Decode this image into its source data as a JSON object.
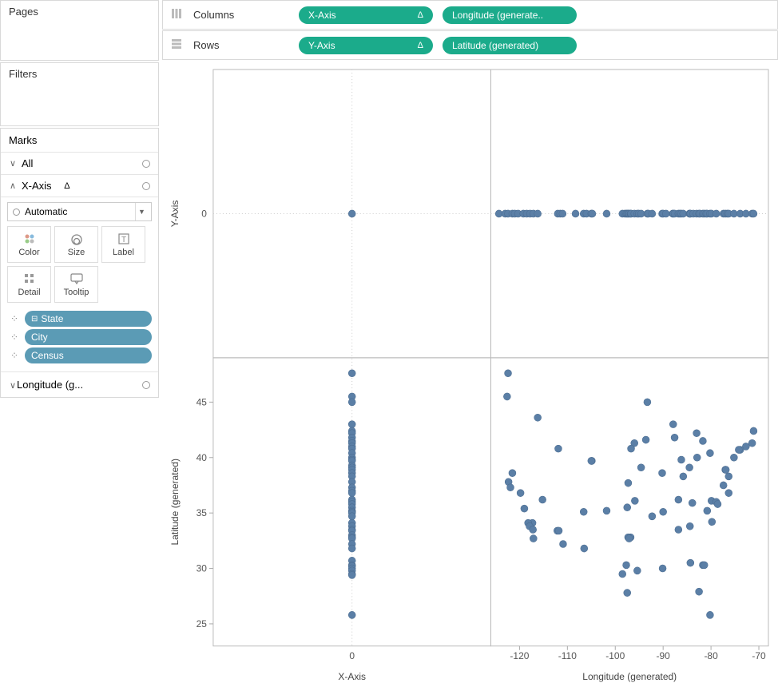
{
  "panels": {
    "pages": "Pages",
    "filters": "Filters",
    "marks": "Marks",
    "all": "All",
    "xaxis_item": "X-Axis",
    "delta": "Δ",
    "automatic": "Automatic",
    "color": "Color",
    "size": "Size",
    "label": "Label",
    "detail": "Detail",
    "tooltip": "Tooltip",
    "state": "State",
    "city": "City",
    "census": "Census",
    "longitude_g": "Longitude (g..."
  },
  "shelves": {
    "columns": "Columns",
    "rows": "Rows",
    "xaxis": "X-Axis",
    "lon_gen_trunc": "Longitude (generate..",
    "yaxis": "Y-Axis",
    "lat_gen": "Latitude (generated)"
  },
  "chart_data": {
    "type": "scatter",
    "panels_layout": "2x2",
    "column_fields": [
      "X-Axis",
      "Longitude (generated)"
    ],
    "row_fields": [
      "Y-Axis",
      "Latitude (generated)"
    ],
    "x_axes": {
      "xaxis_label": "X-Axis",
      "lon_label": "Longitude (generated)",
      "xaxis_ticks": [
        0
      ],
      "lon_ticks": [
        -120,
        -110,
        -100,
        -90,
        -80,
        -70
      ],
      "xaxis_range": [
        -0.5,
        0.5
      ],
      "lon_range": [
        -126,
        -68
      ]
    },
    "y_axes": {
      "yaxis_label": "Y-Axis",
      "lat_label": "Latitude (generated)",
      "yaxis_ticks": [
        0
      ],
      "lat_ticks": [
        25,
        30,
        35,
        40,
        45
      ],
      "yaxis_range": [
        -0.5,
        0.5
      ],
      "lat_range": [
        23,
        49
      ]
    },
    "series": [
      {
        "name": "top-left (X-Axis vs Y-Axis)",
        "points": [
          [
            0,
            0
          ]
        ]
      },
      {
        "name": "top-right (Longitude vs Y-Axis)",
        "points": [
          [
            -124.3,
            0
          ],
          [
            -123.0,
            0
          ],
          [
            -122.4,
            0
          ],
          [
            -121.5,
            0
          ],
          [
            -121.0,
            0
          ],
          [
            -120.3,
            0
          ],
          [
            -119.2,
            0
          ],
          [
            -118.5,
            0
          ],
          [
            -117.8,
            0
          ],
          [
            -117.1,
            0
          ],
          [
            -116.2,
            0
          ],
          [
            -112.0,
            0
          ],
          [
            -111.5,
            0
          ],
          [
            -111.0,
            0
          ],
          [
            -108.3,
            0
          ],
          [
            -106.6,
            0
          ],
          [
            -106.0,
            0
          ],
          [
            -105.0,
            0
          ],
          [
            -104.8,
            0
          ],
          [
            -101.8,
            0
          ],
          [
            -98.5,
            0
          ],
          [
            -98.0,
            0
          ],
          [
            -97.7,
            0
          ],
          [
            -97.5,
            0
          ],
          [
            -97.3,
            0
          ],
          [
            -97.1,
            0
          ],
          [
            -96.8,
            0
          ],
          [
            -96.7,
            0
          ],
          [
            -96.0,
            0
          ],
          [
            -95.4,
            0
          ],
          [
            -95.1,
            0
          ],
          [
            -94.6,
            0
          ],
          [
            -93.3,
            0
          ],
          [
            -93.1,
            0
          ],
          [
            -92.3,
            0
          ],
          [
            -90.2,
            0
          ],
          [
            -90.0,
            0
          ],
          [
            -89.4,
            0
          ],
          [
            -88.0,
            0
          ],
          [
            -87.9,
            0
          ],
          [
            -87.6,
            0
          ],
          [
            -86.8,
            0
          ],
          [
            -86.5,
            0
          ],
          [
            -86.2,
            0
          ],
          [
            -85.8,
            0
          ],
          [
            -84.5,
            0
          ],
          [
            -84.4,
            0
          ],
          [
            -84.3,
            0
          ],
          [
            -83.7,
            0
          ],
          [
            -83.0,
            0
          ],
          [
            -82.5,
            0
          ],
          [
            -82.3,
            0
          ],
          [
            -81.7,
            0
          ],
          [
            -81.4,
            0
          ],
          [
            -81.0,
            0
          ],
          [
            -80.8,
            0
          ],
          [
            -80.2,
            0
          ],
          [
            -79.9,
            0
          ],
          [
            -78.9,
            0
          ],
          [
            -77.4,
            0
          ],
          [
            -77.0,
            0
          ],
          [
            -76.6,
            0
          ],
          [
            -76.3,
            0
          ],
          [
            -75.2,
            0
          ],
          [
            -73.9,
            0
          ],
          [
            -72.7,
            0
          ],
          [
            -71.4,
            0
          ],
          [
            -71.1,
            0
          ]
        ]
      },
      {
        "name": "bottom-left (X-Axis vs Latitude)",
        "points": [
          [
            0,
            47.6
          ],
          [
            0,
            45.5
          ],
          [
            0,
            45.0
          ],
          [
            0,
            43.0
          ],
          [
            0,
            42.4
          ],
          [
            0,
            42.2
          ],
          [
            0,
            41.8
          ],
          [
            0,
            41.5
          ],
          [
            0,
            41.3
          ],
          [
            0,
            41.0
          ],
          [
            0,
            40.8
          ],
          [
            0,
            40.4
          ],
          [
            0,
            40.0
          ],
          [
            0,
            39.8
          ],
          [
            0,
            39.7
          ],
          [
            0,
            39.3
          ],
          [
            0,
            39.1
          ],
          [
            0,
            38.9
          ],
          [
            0,
            38.6
          ],
          [
            0,
            38.3
          ],
          [
            0,
            37.8
          ],
          [
            0,
            37.3
          ],
          [
            0,
            37.0
          ],
          [
            0,
            36.8
          ],
          [
            0,
            36.2
          ],
          [
            0,
            36.0
          ],
          [
            0,
            35.8
          ],
          [
            0,
            35.5
          ],
          [
            0,
            35.2
          ],
          [
            0,
            35.1
          ],
          [
            0,
            35.0
          ],
          [
            0,
            34.7
          ],
          [
            0,
            34.1
          ],
          [
            0,
            33.8
          ],
          [
            0,
            33.5
          ],
          [
            0,
            33.4
          ],
          [
            0,
            33.0
          ],
          [
            0,
            32.8
          ],
          [
            0,
            32.7
          ],
          [
            0,
            32.2
          ],
          [
            0,
            31.8
          ],
          [
            0,
            30.7
          ],
          [
            0,
            30.3
          ],
          [
            0,
            30.2
          ],
          [
            0,
            30.0
          ],
          [
            0,
            29.8
          ],
          [
            0,
            29.5
          ],
          [
            0,
            29.4
          ],
          [
            0,
            25.8
          ]
        ]
      },
      {
        "name": "bottom-right (Longitude vs Latitude)",
        "points": [
          [
            -122.4,
            47.6
          ],
          [
            -122.6,
            45.5
          ],
          [
            -93.3,
            45.0
          ],
          [
            -87.9,
            43.0
          ],
          [
            -71.1,
            42.4
          ],
          [
            -83.0,
            42.2
          ],
          [
            -87.6,
            41.8
          ],
          [
            -81.7,
            41.5
          ],
          [
            -71.4,
            41.3
          ],
          [
            -72.7,
            41.0
          ],
          [
            -96.0,
            41.3
          ],
          [
            -111.9,
            40.8
          ],
          [
            -73.9,
            40.7
          ],
          [
            -75.2,
            40.0
          ],
          [
            -82.9,
            40.0
          ],
          [
            -104.9,
            39.7
          ],
          [
            -105.0,
            39.7
          ],
          [
            -86.2,
            39.8
          ],
          [
            -94.6,
            39.1
          ],
          [
            -84.5,
            39.1
          ],
          [
            -121.5,
            38.6
          ],
          [
            -77.0,
            38.9
          ],
          [
            -76.9,
            38.9
          ],
          [
            -90.2,
            38.6
          ],
          [
            -76.3,
            38.3
          ],
          [
            -85.8,
            38.3
          ],
          [
            -122.3,
            37.8
          ],
          [
            -121.9,
            37.3
          ],
          [
            -76.3,
            36.8
          ],
          [
            -119.8,
            36.8
          ],
          [
            -79.9,
            36.1
          ],
          [
            -78.9,
            36.0
          ],
          [
            -86.8,
            36.2
          ],
          [
            -115.2,
            36.2
          ],
          [
            -95.9,
            36.1
          ],
          [
            -80.8,
            35.2
          ],
          [
            -106.6,
            35.1
          ],
          [
            -90.0,
            35.1
          ],
          [
            -97.5,
            35.5
          ],
          [
            -101.8,
            35.2
          ],
          [
            -119.0,
            35.4
          ],
          [
            -117.3,
            34.1
          ],
          [
            -118.2,
            34.1
          ],
          [
            -84.4,
            33.8
          ],
          [
            -117.9,
            33.8
          ],
          [
            -117.2,
            33.5
          ],
          [
            -112.1,
            33.4
          ],
          [
            -86.8,
            33.5
          ],
          [
            -111.8,
            33.4
          ],
          [
            -117.1,
            32.7
          ],
          [
            -96.8,
            32.8
          ],
          [
            -97.3,
            32.8
          ],
          [
            -106.5,
            31.8
          ],
          [
            -110.9,
            32.2
          ],
          [
            -97.1,
            32.7
          ],
          [
            -81.7,
            30.3
          ],
          [
            -97.7,
            30.3
          ],
          [
            -81.4,
            30.3
          ],
          [
            -90.1,
            30.0
          ],
          [
            -95.4,
            29.8
          ],
          [
            -98.5,
            29.5
          ],
          [
            -97.5,
            27.8
          ],
          [
            -80.2,
            25.8
          ],
          [
            -82.5,
            27.9
          ],
          [
            -78.6,
            35.8
          ],
          [
            -74.2,
            40.7
          ],
          [
            -80.2,
            40.4
          ],
          [
            -84.3,
            30.5
          ],
          [
            -77.4,
            37.5
          ],
          [
            -93.6,
            41.6
          ],
          [
            -92.3,
            34.7
          ],
          [
            -97.3,
            37.7
          ],
          [
            -83.9,
            35.9
          ],
          [
            -79.8,
            34.2
          ],
          [
            -96.7,
            40.8
          ],
          [
            -116.2,
            43.6
          ]
        ]
      }
    ]
  }
}
